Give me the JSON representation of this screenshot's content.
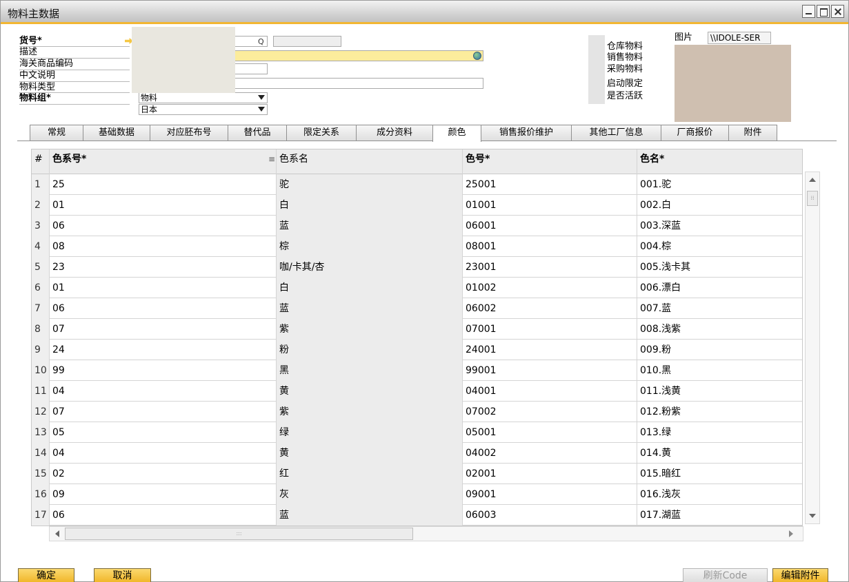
{
  "window": {
    "title": "物料主数据"
  },
  "header": {
    "item_no_label": "货号*",
    "description_label": "描述",
    "customs_code_label": "海关商品编码",
    "chinese_desc_label": "中文说明",
    "item_type_label": "物料类型",
    "item_type_value": "物料",
    "item_group_label": "物料组*",
    "item_group_value": "日本",
    "search_icon_glyph": "Q"
  },
  "flags": {
    "inventory": "仓库物料",
    "sales": "销售物料",
    "purchase": "采购物料",
    "enable_limit": "启动限定",
    "active": "是否活跃"
  },
  "picture": {
    "label": "图片",
    "path": "\\\\IDOLE-SER"
  },
  "tabs": [
    {
      "label": "常规"
    },
    {
      "label": "基础数据"
    },
    {
      "label": "对应胚布号"
    },
    {
      "label": "替代品"
    },
    {
      "label": "限定关系"
    },
    {
      "label": "成分资料"
    },
    {
      "label": "颜色"
    },
    {
      "label": "销售报价维护"
    },
    {
      "label": "其他工厂信息"
    },
    {
      "label": "厂商报价"
    },
    {
      "label": "附件"
    }
  ],
  "grid": {
    "columns": [
      "#",
      "色系号*",
      "色系名",
      "色号*",
      "色名*"
    ],
    "rows": [
      [
        "1",
        "25",
        "驼",
        "25001",
        "001.驼"
      ],
      [
        "2",
        "01",
        "白",
        "01001",
        "002.白"
      ],
      [
        "3",
        "06",
        "蓝",
        "06001",
        "003.深蓝"
      ],
      [
        "4",
        "08",
        "棕",
        "08001",
        "004.棕"
      ],
      [
        "5",
        "23",
        "咖/卡其/杏",
        "23001",
        "005.浅卡其"
      ],
      [
        "6",
        "01",
        "白",
        "01002",
        "006.漂白"
      ],
      [
        "7",
        "06",
        "蓝",
        "06002",
        "007.蓝"
      ],
      [
        "8",
        "07",
        "紫",
        "07001",
        "008.浅紫"
      ],
      [
        "9",
        "24",
        "粉",
        "24001",
        "009.粉"
      ],
      [
        "10",
        "99",
        "黑",
        "99001",
        "010.黑"
      ],
      [
        "11",
        "04",
        "黄",
        "04001",
        "011.浅黄"
      ],
      [
        "12",
        "07",
        "紫",
        "07002",
        "012.粉紫"
      ],
      [
        "13",
        "05",
        "绿",
        "05001",
        "013.绿"
      ],
      [
        "14",
        "04",
        "黄",
        "04002",
        "014.黄"
      ],
      [
        "15",
        "02",
        "红",
        "02001",
        "015.暗红"
      ],
      [
        "16",
        "09",
        "灰",
        "09001",
        "016.浅灰"
      ],
      [
        "17",
        "06",
        "蓝",
        "06003",
        "017.湖蓝"
      ]
    ]
  },
  "buttons": {
    "ok": "确定",
    "cancel": "取消",
    "refresh_code": "刷新Code",
    "edit_attachment": "编辑附件"
  },
  "colors": {
    "accent": "#f2b631",
    "field_highlight": "#fcec9c"
  }
}
